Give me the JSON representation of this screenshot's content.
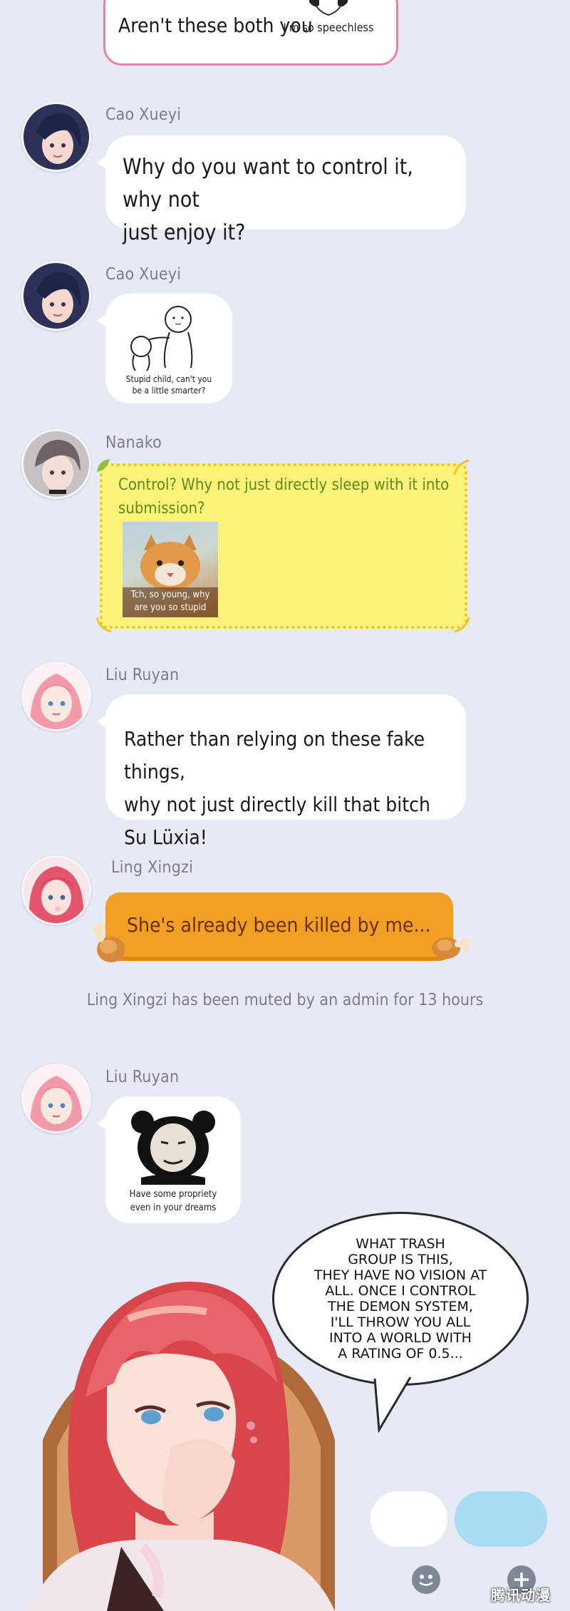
{
  "top_message": {
    "text": "Aren't these both you",
    "sticker_caption": "I'm so speechless"
  },
  "messages": [
    {
      "sender": "Cao Xueyi",
      "text": "Why do you want to control it, why not\njust enjoy it?"
    },
    {
      "sender": "Cao Xueyi",
      "sticker_caption": "Stupid child, can't you\nbe a little smarter?"
    },
    {
      "sender": "Nanako",
      "text": "Control? Why not just directly sleep with it into\nsubmission?",
      "sticker_caption": "Tch, so young, why\nare you so stupid"
    },
    {
      "sender": "Liu Ruyan",
      "text": "Rather than relying on these fake things,\nwhy not just directly kill that bitch Su Lüxia!"
    },
    {
      "sender": "Ling Xingzi",
      "text": "She's already been killed by me..."
    },
    {
      "sender": "Liu Ruyan",
      "sticker_caption": "Have some propriety\neven in your dreams"
    }
  ],
  "system_notice": "Ling Xingzi has been muted by an admin for 13 hours",
  "speech_bubble": "WHAT TRASH\nGROUP IS THIS,\nTHEY HAVE NO VISION AT\nALL. ONCE I CONTROL\nTHE DEMON SYSTEM,\nI'LL THROW YOU ALL\nINTO A WORLD WITH\nA RATING OF 0.5...",
  "watermark": "腾讯动漫",
  "icons": [
    "smiley-icon",
    "plus-icon"
  ],
  "colors": {
    "background": "#e7e9f4",
    "nanako_bubble": "#fbf27a",
    "nanako_text": "#5f8a1c",
    "ling_bubble": "#f2a024",
    "ling_text": "#6b2f0a",
    "top_border": "#e586a8",
    "send_button": "#a9dcf3"
  }
}
